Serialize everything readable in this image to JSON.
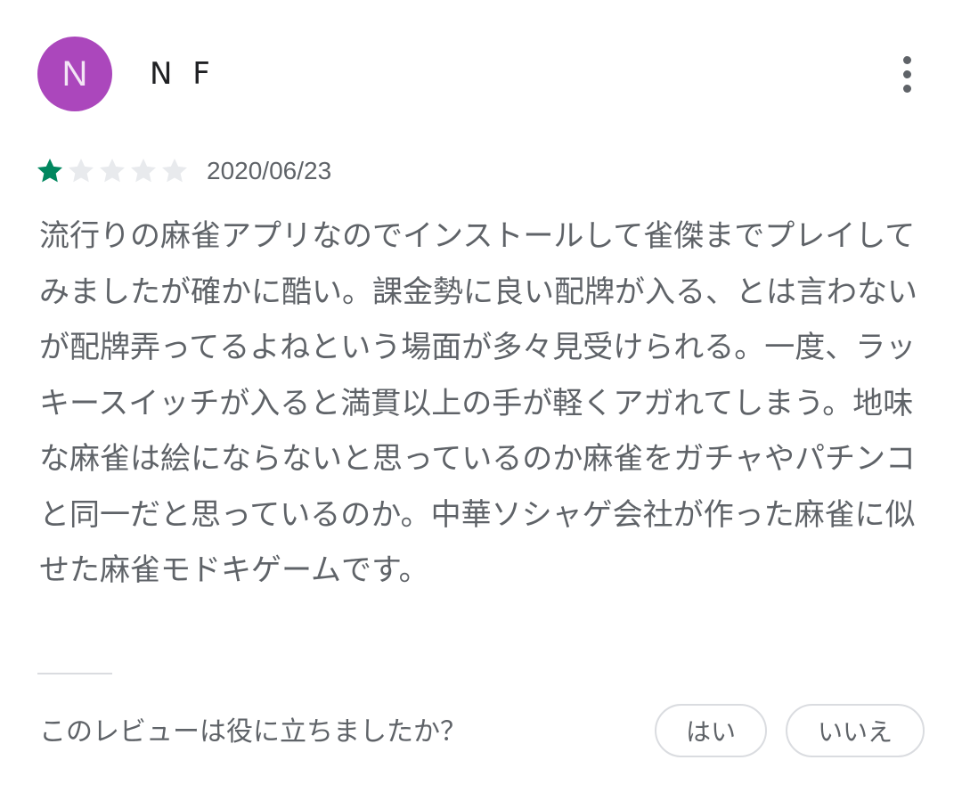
{
  "reviewer": {
    "avatar_initial": "N",
    "avatar_color": "#ab47bc",
    "name": "N F"
  },
  "rating": {
    "value": 1,
    "max": 5,
    "filled_color": "#01875f",
    "empty_color": "#e8eaed"
  },
  "review": {
    "date": "2020/06/23",
    "text": "流行りの麻雀アプリなのでインストールして雀傑までプレイしてみましたが確かに酷い。課金勢に良い配牌が入る、とは言わないが配牌弄ってるよねという場面が多々見受けられる。一度、ラッキースイッチが入ると満貫以上の手が軽くアガれてしまう。地味な麻雀は絵にならないと思っているのか麻雀をガチャやパチンコと同一だと思っているのか。中華ソシャゲ会社が作った麻雀に似せた麻雀モドキゲームです。"
  },
  "helpful": {
    "question": "このレビューは役に立ちましたか？",
    "yes_label": "はい",
    "no_label": "いいえ"
  },
  "icons": {
    "menu": "more-vertical-icon",
    "star": "star-icon"
  }
}
